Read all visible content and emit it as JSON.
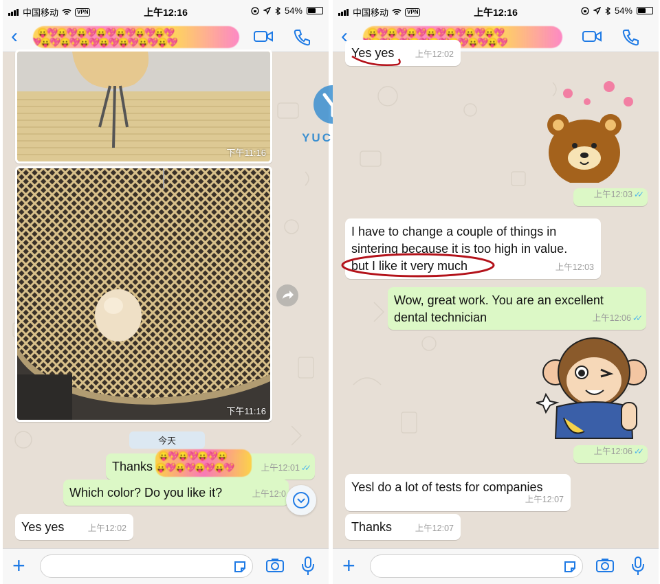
{
  "left": {
    "status": {
      "carrier": "中国移动",
      "vpn": "VPN",
      "time": "上午12:16",
      "battery": "54%"
    },
    "photos": [
      {
        "time": "下午11:16"
      },
      {
        "time": "下午11:16"
      }
    ],
    "day_badge": "今天",
    "messages": [
      {
        "text": "Thanks",
        "time": "上午12:01",
        "type": "out"
      },
      {
        "text": "Which color? Do you like it?",
        "time": "上午12:0",
        "type": "out"
      },
      {
        "text": "Yes yes",
        "time": "上午12:02",
        "type": "in"
      }
    ]
  },
  "right": {
    "status": {
      "carrier": "中国移动",
      "vpn": "VPN",
      "time": "上午12:16",
      "battery": "54%"
    },
    "top_partial": {
      "text": "Yes yes",
      "time": "上午12:02"
    },
    "sticker1_time": "上午12:03",
    "messages": [
      {
        "lines": [
          "I have to change a couple of things in",
          "sintering because it is too high in value.",
          "but I like it very much"
        ],
        "time": "上午12:03",
        "type": "in"
      },
      {
        "lines": [
          "Wow, great work. You are an excellent",
          "dental technician"
        ],
        "time": "上午12:06",
        "type": "out"
      },
      {
        "text": "Yesl do a lot of tests for companies",
        "time": "上午12:07",
        "type": "in"
      },
      {
        "text": "Thanks",
        "time": "上午12:07",
        "type": "in"
      }
    ],
    "sticker2_time": "上午12:06"
  },
  "watermark": {
    "text": "YUCERA"
  },
  "colors": {
    "accent": "#1e7ae5",
    "outgoing": "#dcf8c6",
    "incoming": "#ffffff",
    "wallpaper": "#e7dfd6",
    "highlight": "#b3121a"
  }
}
